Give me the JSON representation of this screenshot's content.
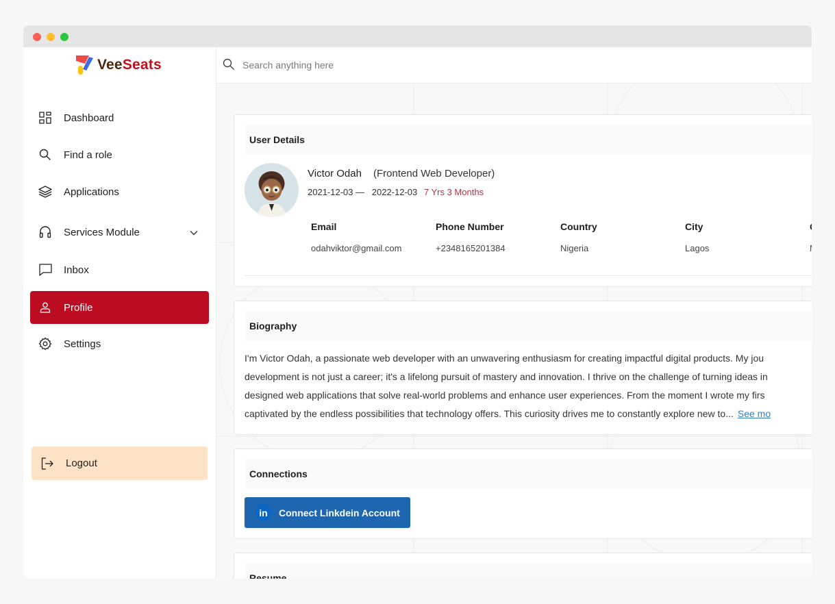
{
  "brand": {
    "name_part1": "Vee",
    "name_part2": "Seats"
  },
  "search": {
    "placeholder": "Search anything here",
    "value": ""
  },
  "sidebar": {
    "items": [
      {
        "label": "Dashboard",
        "icon": "dashboard-icon"
      },
      {
        "label": "Find a role",
        "icon": "search-icon"
      },
      {
        "label": "Applications",
        "icon": "layers-icon"
      },
      {
        "label": "Services Module",
        "icon": "headphones-icon"
      },
      {
        "label": "Inbox",
        "icon": "message-icon"
      },
      {
        "label": "Profile",
        "icon": "user-icon",
        "active": true
      },
      {
        "label": "Settings",
        "icon": "gear-icon"
      }
    ],
    "logout": {
      "label": "Logout",
      "icon": "logout-icon"
    }
  },
  "user_details": {
    "title": "User Details",
    "name": "Victor Odah",
    "role": "(Frontend Web Developer)",
    "start_date": "2021-12-03 —",
    "end_date": "2022-12-03",
    "duration": "7 Yrs 3 Months",
    "fields": [
      {
        "label": "Email",
        "value": "odahviktor@gmail.com"
      },
      {
        "label": "Phone Number",
        "value": "+2348165201384"
      },
      {
        "label": "Country",
        "value": "Nigeria"
      },
      {
        "label": "City",
        "value": "Lagos"
      },
      {
        "label": "G",
        "value": "M"
      }
    ]
  },
  "biography": {
    "title": "Biography",
    "lines": [
      "I'm Victor Odah, a passionate web developer with an unwavering enthusiasm for creating impactful digital products. My jou",
      "development is not just a career; it's a lifelong pursuit of mastery and innovation. I thrive on the challenge of turning ideas in",
      "designed web applications that solve real-world problems and enhance user experiences. From the moment I wrote my firs",
      "captivated by the endless possibilities that technology offers. This curiosity drives me to constantly explore new to..."
    ],
    "see_more": "See mo"
  },
  "connections": {
    "title": "Connections",
    "linkedin_label": "Connect Linkdein Account",
    "linkedin_badge": "in"
  },
  "resume": {
    "title": "Resume"
  },
  "colors": {
    "accent": "#bc0c22",
    "logout_bg": "#fde3c6",
    "linkedin": "#1f66b1",
    "duration": "#a8394a"
  }
}
